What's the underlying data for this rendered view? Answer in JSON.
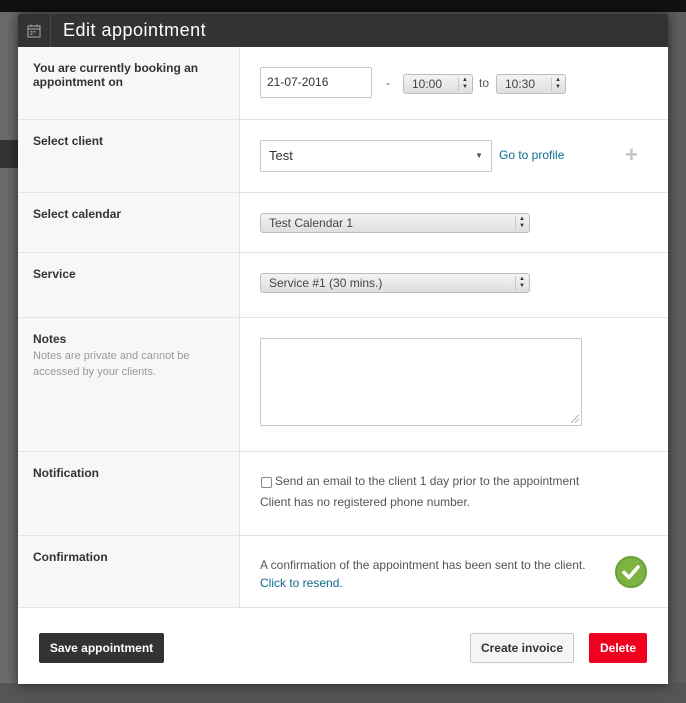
{
  "modal": {
    "title": "Edit appointment",
    "icon": "calendar-icon"
  },
  "booking": {
    "label": "You are currently booking an appointment on",
    "date": "21-07-2016",
    "separator": "-",
    "start_time": "10:00",
    "to_label": "to",
    "end_time": "10:30"
  },
  "client": {
    "label": "Select client",
    "value": "Test",
    "profile_link": "Go to profile",
    "add_icon": "plus-icon"
  },
  "calendar": {
    "label": "Select calendar",
    "value": "Test Calendar 1"
  },
  "service": {
    "label": "Service",
    "value": "Service #1 (30 mins.)"
  },
  "notes": {
    "label": "Notes",
    "help": "Notes are private and cannot be accessed by your clients.",
    "value": ""
  },
  "notification": {
    "label": "Notification",
    "checkbox_label": "Send an email to the client 1 day prior to the appointment",
    "checked": false,
    "phone_message": "Client has no registered phone number."
  },
  "confirmation": {
    "label": "Confirmation",
    "message": "A confirmation of the appointment has been sent to the client.",
    "resend_link": "Click to resend.",
    "status_icon": "check-circle-icon",
    "status_color": "#7cb342"
  },
  "footer": {
    "save_label": "Save appointment",
    "invoice_label": "Create invoice",
    "delete_label": "Delete",
    "delete_color": "#f0001e"
  }
}
